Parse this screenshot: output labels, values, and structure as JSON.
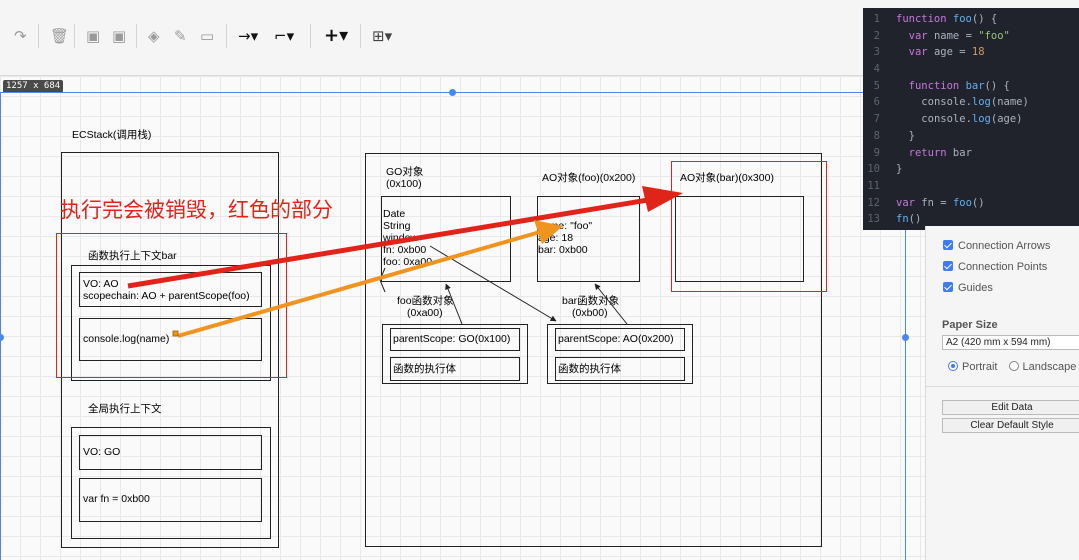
{
  "toolbar": {
    "icons": [
      "redo-icon",
      "delete-icon",
      "to-front-icon",
      "to-back-icon",
      "fill-color-icon",
      "line-color-icon",
      "shadow-icon",
      "connection-icon",
      "waypoints-icon",
      "insert-icon",
      "table-icon"
    ]
  },
  "canvas": {
    "size_badge": "1257 x 684"
  },
  "code": {
    "lines": [
      {
        "n": "1",
        "t": "function foo() {"
      },
      {
        "n": "2",
        "t": "  var name = \"foo\""
      },
      {
        "n": "3",
        "t": "  var age = 18"
      },
      {
        "n": "4",
        "t": ""
      },
      {
        "n": "5",
        "t": "  function bar() {"
      },
      {
        "n": "6",
        "t": "    console.log(name)"
      },
      {
        "n": "7",
        "t": "    console.log(age)"
      },
      {
        "n": "8",
        "t": "  }"
      },
      {
        "n": "9",
        "t": "  return bar"
      },
      {
        "n": "10",
        "t": "}"
      },
      {
        "n": "11",
        "t": ""
      },
      {
        "n": "12",
        "t": "var fn = foo()"
      },
      {
        "n": "13",
        "t": "fn()"
      }
    ]
  },
  "panel": {
    "connection_arrows": "Connection Arrows",
    "connection_points": "Connection Points",
    "guides": "Guides",
    "paper_size": "Paper Size",
    "paper_value": "A2 (420 mm x 594 mm)",
    "portrait": "Portrait",
    "landscape": "Landscape",
    "edit_data": "Edit Data",
    "clear_default_style": "Clear Default Style"
  },
  "diagram": {
    "ecstack_title": "ECStack(调用栈)",
    "red_caption": "执行完会被销毁，红色的部分",
    "bar_ctx_title": "函数执行上下文bar",
    "bar_vo_line1": "VO: AO",
    "bar_vo_line2": "scopechain: AO + parentScope(foo)",
    "bar_console": "console.log(name)",
    "global_ctx_title": "全局执行上下文",
    "global_vo": "VO: GO",
    "global_fn": "var fn = 0xb00",
    "go_title": "GO对象",
    "go_addr": "(0x100)",
    "go_lines": [
      "Date",
      "String",
      "window",
      "fn: 0xb00",
      "foo: 0xa00"
    ],
    "ao_foo_title": "AO对象(foo)(0x200)",
    "ao_foo_lines": [
      "name: \"foo\"",
      "age: 18",
      "bar: 0xb00"
    ],
    "ao_bar_title": "AO对象(bar)(0x300)",
    "foo_fn_title": "foo函数对象",
    "foo_fn_addr": "(0xa00)",
    "foo_parent": "parentScope: GO(0x100)",
    "foo_body": "函数的执行体",
    "bar_fn_title": "bar函数对象",
    "bar_fn_addr": "(0xb00)",
    "bar_parent": "parentScope: AO(0x200)",
    "bar_body": "函数的执行体"
  },
  "colors": {
    "accent": "#e2231a",
    "arrow_orange": "#f0931f",
    "selection": "#4a86f0"
  }
}
